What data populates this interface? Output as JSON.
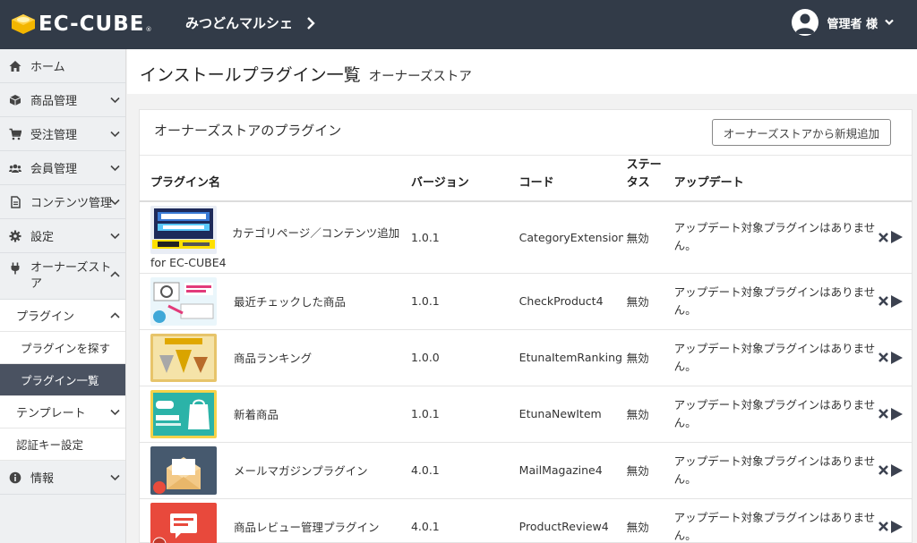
{
  "header": {
    "logo_text": "EC-CUBE",
    "logo_reg": "®",
    "shop_name": "みつどんマルシェ",
    "user_name": "管理者 様"
  },
  "sidebar": {
    "items": [
      {
        "label": "ホーム",
        "icon": "home-icon"
      },
      {
        "label": "商品管理",
        "icon": "box-icon"
      },
      {
        "label": "受注管理",
        "icon": "cart-icon"
      },
      {
        "label": "会員管理",
        "icon": "users-icon"
      },
      {
        "label": "コンテンツ管理",
        "icon": "file-icon"
      },
      {
        "label": "設定",
        "icon": "gear-icon"
      },
      {
        "label": "オーナーズストア",
        "icon": "plug-icon"
      }
    ],
    "owner_sub": {
      "plugin": "プラグイン",
      "find": "プラグインを探す",
      "list": "プラグイン一覧",
      "template": "テンプレート",
      "auth": "認証キー設定"
    },
    "info": {
      "label": "情報",
      "icon": "info-icon"
    }
  },
  "page": {
    "title": "インストールプラグイン一覧",
    "subtitle": "オーナーズストア"
  },
  "card": {
    "title": "オーナーズストアのプラグイン",
    "add_button": "オーナーズストアから新規追加",
    "columns": {
      "name": "プラグイン名",
      "version": "バージョン",
      "code": "コード",
      "status": "ステータス",
      "update": "アップデート"
    },
    "plugins": [
      {
        "name": "カテゴリページ／コンテンツ追加",
        "name_cont": "for EC-CUBE4",
        "version": "1.0.1",
        "code": "CategoryExtensionB",
        "status": "無効",
        "update": "アップデート対象プラグインはありません。",
        "thumb": "thumb-category-content"
      },
      {
        "name": "最近チェックした商品",
        "version": "1.0.1",
        "code": "CheckProduct4",
        "status": "無効",
        "update": "アップデート対象プラグインはありません。",
        "thumb": "thumb-check-product"
      },
      {
        "name": "商品ランキング",
        "version": "1.0.0",
        "code": "EtunaItemRanking",
        "status": "無効",
        "update": "アップデート対象プラグインはありません。",
        "thumb": "thumb-ranking"
      },
      {
        "name": "新着商品",
        "version": "1.0.1",
        "code": "EtunaNewItem",
        "status": "無効",
        "update": "アップデート対象プラグインはありません。",
        "thumb": "thumb-new-item"
      },
      {
        "name": "メールマガジンプラグイン",
        "version": "4.0.1",
        "code": "MailMagazine4",
        "status": "無効",
        "update": "アップデート対象プラグインはありません。",
        "thumb": "thumb-mail-magazine"
      },
      {
        "name": "商品レビュー管理プラグイン",
        "version": "4.0.1",
        "code": "ProductReview4",
        "status": "無効",
        "update": "アップデート対象プラグインはありません。",
        "thumb": "thumb-product-review"
      }
    ]
  },
  "colors": {
    "topbar": "#323b48",
    "sidebar": "#eef0f2",
    "active": "#4a5261",
    "action_icon": "#3c4250"
  }
}
